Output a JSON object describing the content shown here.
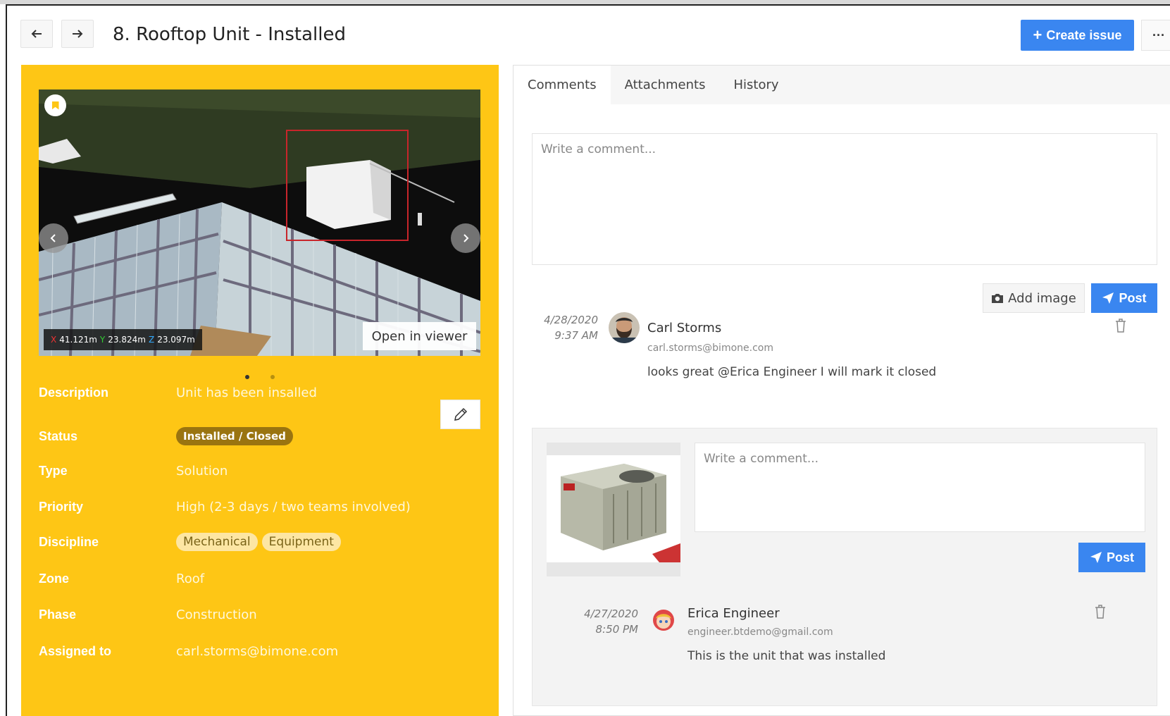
{
  "header": {
    "title": "8. Rooftop Unit - Installed",
    "create_label": "Create issue",
    "more_label": "···"
  },
  "viewer": {
    "coords": {
      "x": "41.121m",
      "y": "23.824m",
      "z": "23.097m",
      "x_axis": "X",
      "y_axis": "Y",
      "z_axis": "Z"
    },
    "open_label": "Open in viewer"
  },
  "properties": {
    "description": {
      "label": "Description",
      "value": "Unit has been insalled"
    },
    "status": {
      "label": "Status",
      "value": "Installed / Closed"
    },
    "type": {
      "label": "Type",
      "value": "Solution"
    },
    "priority": {
      "label": "Priority",
      "value": "High (2-3 days / two teams involved)"
    },
    "discipline": {
      "label": "Discipline",
      "tags": [
        "Mechanical",
        "Equipment"
      ]
    },
    "zone": {
      "label": "Zone",
      "value": "Roof"
    },
    "phase": {
      "label": "Phase",
      "value": "Construction"
    },
    "assigned": {
      "label": "Assigned to",
      "value": "carl.storms@bimone.com"
    }
  },
  "tabs": [
    "Comments",
    "Attachments",
    "History"
  ],
  "comment_form": {
    "placeholder": "Write a comment...",
    "add_image_label": "Add image",
    "post_label": "Post"
  },
  "comments": [
    {
      "date": "4/28/2020",
      "time": "9:37 AM",
      "name": "Carl Storms",
      "email": "carl.storms@bimone.com",
      "text": "looks great @Erica Engineer I will mark it closed"
    },
    {
      "date": "4/27/2020",
      "time": "8:50 PM",
      "name": "Erica Engineer",
      "email": "engineer.btdemo@gmail.com",
      "text": "This is the unit that was installed"
    }
  ],
  "reply_form": {
    "placeholder": "Write a comment...",
    "post_label": "Post"
  },
  "colors": {
    "panel": "#fec615",
    "primary": "#3a86f0",
    "status_badge": "#9a7410"
  }
}
